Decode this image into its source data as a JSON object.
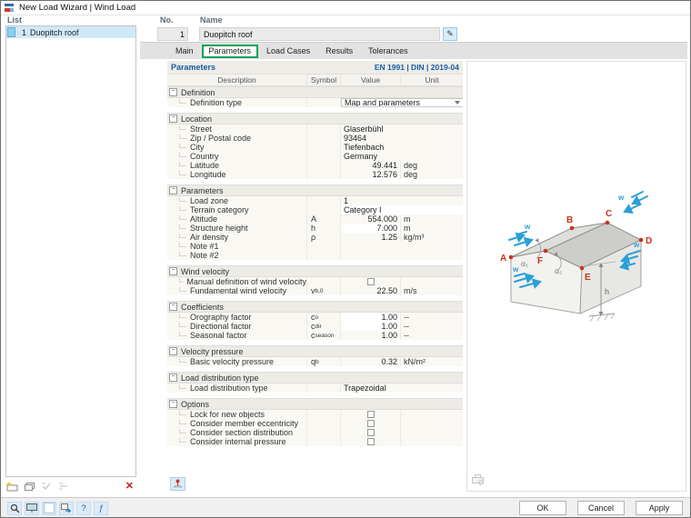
{
  "window": {
    "title": "New Load Wizard | Wind Load"
  },
  "list_panel": {
    "label": "List",
    "items": [
      {
        "number": "1",
        "name": "Duopitch roof",
        "selected": true
      }
    ],
    "toolbar": {
      "delete_glyph": "✕"
    }
  },
  "header": {
    "no_label": "No.",
    "no_value": "1",
    "name_label": "Name",
    "name_value": "Duopitch roof"
  },
  "tabs": [
    {
      "label": "Main",
      "active": false
    },
    {
      "label": "Parameters",
      "active": true
    },
    {
      "label": "Load Cases",
      "active": false
    },
    {
      "label": "Results",
      "active": false
    },
    {
      "label": "Tolerances",
      "active": false
    }
  ],
  "parameters_panel": {
    "title": "Parameters",
    "standard": "EN 1991 | DIN | 2019-04",
    "columns": [
      "Description",
      "Symbol",
      "Value",
      "Unit"
    ],
    "sections": [
      {
        "title": "Definition",
        "rows": [
          {
            "description": "Definition type",
            "value": "Map and parameters",
            "control": "dropdown"
          }
        ]
      },
      {
        "title": "Location",
        "rows": [
          {
            "description": "Street",
            "value": "Glaserbühl",
            "wide": true
          },
          {
            "description": "Zip / Postal code",
            "value": "93464",
            "wide": true
          },
          {
            "description": "City",
            "value": "Tiefenbach",
            "wide": true
          },
          {
            "description": "Country",
            "value": "Germany",
            "wide": true
          },
          {
            "description": "Latitude",
            "value": "49.441",
            "unit": "deg"
          },
          {
            "description": "Longitude",
            "value": "12.576",
            "unit": "deg"
          }
        ]
      },
      {
        "title": "Parameters",
        "rows": [
          {
            "description": "Load zone",
            "value": "1",
            "wide": true
          },
          {
            "description": "Terrain category",
            "value": "Category I",
            "wide": true,
            "editable": true
          },
          {
            "description": "Altitude",
            "symbol": "A",
            "value": "554.000",
            "unit": "m"
          },
          {
            "description": "Structure height",
            "symbol": "h",
            "value": "7.000",
            "unit": "m",
            "editable": true
          },
          {
            "description": "Air density",
            "symbol": "ρ",
            "value": "1.25",
            "unit": "kg/m³"
          },
          {
            "description": "Note #1",
            "value": "",
            "wide": true
          },
          {
            "description": "Note #2",
            "value": "",
            "wide": true
          }
        ]
      },
      {
        "title": "Wind velocity",
        "rows": [
          {
            "description": "Manual definition of wind velocity",
            "control": "checkbox",
            "checked": false
          },
          {
            "description": "Fundamental wind velocity",
            "symbol": "v",
            "symbol_sub": "b,0",
            "value": "22.50",
            "unit": "m/s"
          }
        ]
      },
      {
        "title": "Coefficients",
        "rows": [
          {
            "description": "Orography factor",
            "symbol": "c",
            "symbol_sub": "o",
            "value": "1.00",
            "unit": "--",
            "editable": true
          },
          {
            "description": "Directional factor",
            "symbol": "c",
            "symbol_sub": "dir",
            "value": "1.00",
            "unit": "--",
            "editable": true
          },
          {
            "description": "Seasonal factor",
            "symbol": "c",
            "symbol_sub": "season",
            "value": "1.00",
            "unit": "--"
          }
        ]
      },
      {
        "title": "Velocity pressure",
        "rows": [
          {
            "description": "Basic velocity pressure",
            "symbol": "q",
            "symbol_sub": "b",
            "value": "0.32",
            "unit": "kN/m²"
          }
        ]
      },
      {
        "title": "Load distribution type",
        "rows": [
          {
            "description": "Load distribution type",
            "value": "Trapezoidal",
            "wide": true
          }
        ]
      },
      {
        "title": "Options",
        "rows": [
          {
            "description": "Lock for new objects",
            "control": "checkbox",
            "checked": false
          },
          {
            "description": "Consider member eccentricity",
            "control": "checkbox",
            "checked": false
          },
          {
            "description": "Consider section distribution",
            "control": "checkbox",
            "checked": false
          },
          {
            "description": "Consider internal pressure",
            "control": "checkbox",
            "checked": false
          }
        ]
      }
    ]
  },
  "diagram": {
    "points": [
      "A",
      "B",
      "C",
      "D",
      "E",
      "F"
    ],
    "alpha1": "α₁",
    "alpha2": "α₂",
    "height_label": "h",
    "wind_label": "w",
    "accent_red": "#c8311c",
    "wind_blue": "#2b9fd9"
  },
  "footer": {
    "ok": "OK",
    "cancel": "Cancel",
    "apply": "Apply"
  },
  "ui": {
    "collapse_glyph": "−",
    "edit_glyph": "✎",
    "help_glyph": "?",
    "fx_glyph": "ƒ"
  }
}
